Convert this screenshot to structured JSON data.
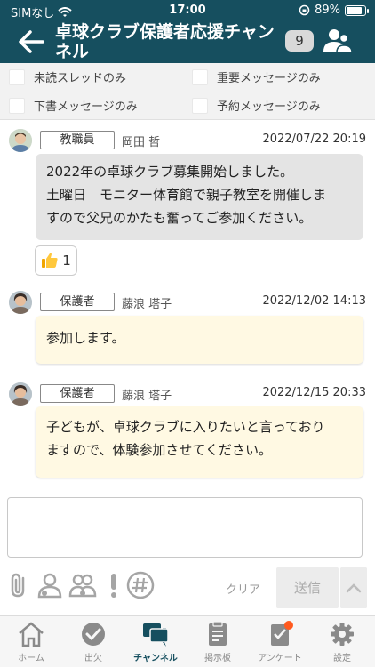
{
  "status_bar": {
    "carrier": "SIMなし",
    "time": "17:00",
    "battery": "89%"
  },
  "header": {
    "title": "卓球クラブ保護者応援チャンネル",
    "member_count": "9"
  },
  "filters": [
    {
      "label": "未読スレッドのみ"
    },
    {
      "label": "重要メッセージのみ"
    },
    {
      "label": "下書メッセージのみ"
    },
    {
      "label": "予約メッセージのみ"
    }
  ],
  "messages": [
    {
      "role": "教職員",
      "sender": "岡田 哲",
      "datetime": "2022/07/22 20:19",
      "lines": [
        "2022年の卓球クラブ募集開始しました。",
        "土曜日　モニター体育館で親子教室を開催しま",
        "すので父兄のかたも奮ってご参加ください。"
      ],
      "reaction": {
        "icon": "thumbs-up-icon",
        "count": "1"
      }
    },
    {
      "role": "保護者",
      "sender": "藤浪 塔子",
      "datetime": "2022/12/02 14:13",
      "lines": [
        "参加します。"
      ]
    },
    {
      "role": "保護者",
      "sender": "藤浪 塔子",
      "datetime": "2022/12/15 20:33",
      "lines": [
        "子どもが、卓球クラブに入りたいと言っており",
        "ますので、体験参加させてください。"
      ]
    }
  ],
  "composer": {
    "clear_label": "クリア",
    "send_label": "送信"
  },
  "tools": [
    "attachment-icon",
    "mention-person-icon",
    "mention-group-icon",
    "important-icon",
    "hashtag-icon"
  ],
  "nav": [
    {
      "label": "ホーム",
      "icon": "home-icon"
    },
    {
      "label": "出欠",
      "icon": "attendance-check-icon"
    },
    {
      "label": "チャンネル",
      "icon": "channel-chat-icon",
      "active": true
    },
    {
      "label": "掲示板",
      "icon": "bulletin-board-icon"
    },
    {
      "label": "アンケート",
      "icon": "survey-icon",
      "badge": true
    },
    {
      "label": "設定",
      "icon": "settings-gear-icon"
    }
  ],
  "colors": {
    "header": "#164f5f",
    "message_staff_bg": "#e4e4e4",
    "message_parent_bg": "#fff9e3",
    "badge": "#ff5a1f"
  }
}
